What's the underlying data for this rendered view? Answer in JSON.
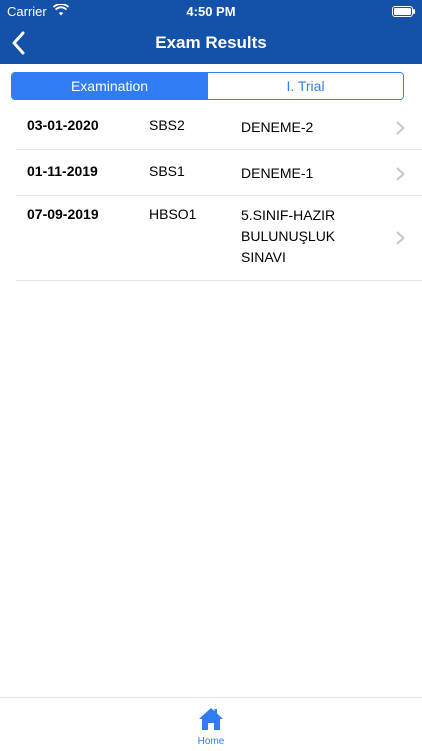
{
  "status_bar": {
    "carrier": "Carrier",
    "time": "4:50 PM",
    "battery_level": 1.0
  },
  "nav": {
    "title": "Exam Results",
    "back_icon": "chevron-left-icon"
  },
  "segments": {
    "selected": "Examination",
    "items": [
      {
        "label": "Examination",
        "active": true
      },
      {
        "label": "I. Trial",
        "active": false
      }
    ]
  },
  "results": [
    {
      "date": "03-01-2020",
      "code": "SBS2",
      "name": "DENEME-2"
    },
    {
      "date": "01-11-2019",
      "code": "SBS1",
      "name": "DENEME-1"
    },
    {
      "date": "07-09-2019",
      "code": "HBSO1",
      "name": "5.SINIF-HAZIR BULUNUŞLUK SINAVI"
    }
  ],
  "tabbar": {
    "items": [
      {
        "label": "Home",
        "icon": "home-icon"
      }
    ]
  },
  "colors": {
    "header": "#1451a8",
    "accent": "#2f7cf4",
    "separator": "#e6e6e6"
  }
}
